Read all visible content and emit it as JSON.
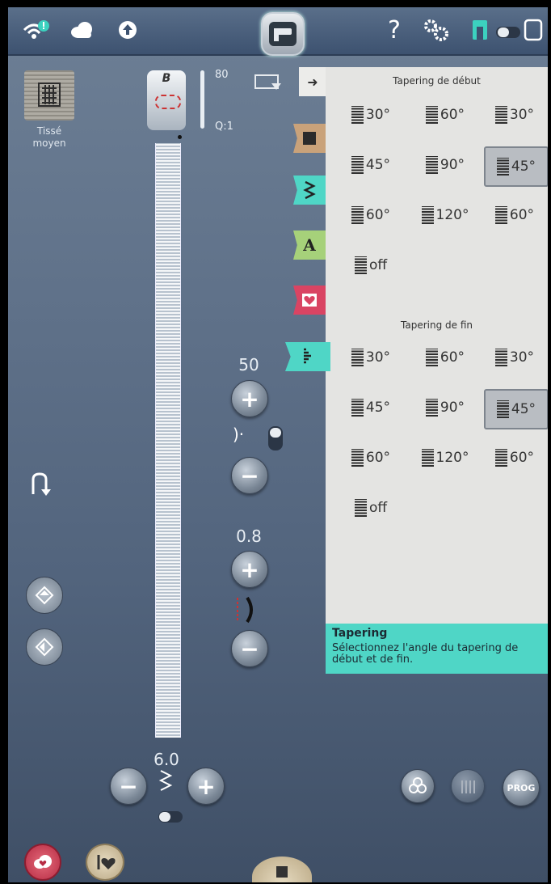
{
  "topbar": {
    "help_label": "?"
  },
  "fabric": {
    "line1": "Tissé",
    "line2": "moyen"
  },
  "presser": {
    "letter": "B",
    "needle_size": "80",
    "q_value": "Q:1"
  },
  "panel": {
    "start_title": "Tapering de début",
    "end_title": "Tapering de fin",
    "start_options": [
      {
        "label": "30°"
      },
      {
        "label": "60°"
      },
      {
        "label": "30°"
      },
      {
        "label": "45°"
      },
      {
        "label": "90°"
      },
      {
        "label": "45°",
        "selected": true
      },
      {
        "label": "60°"
      },
      {
        "label": "120°"
      },
      {
        "label": "60°"
      },
      {
        "label": "off"
      }
    ],
    "end_options": [
      {
        "label": "30°"
      },
      {
        "label": "60°"
      },
      {
        "label": "30°"
      },
      {
        "label": "45°"
      },
      {
        "label": "90°"
      },
      {
        "label": "45°",
        "selected": true
      },
      {
        "label": "60°"
      },
      {
        "label": "120°"
      },
      {
        "label": "60°"
      },
      {
        "label": "off"
      }
    ]
  },
  "tabs": {
    "letter_tab": "A"
  },
  "help": {
    "title": "Tapering",
    "description": "Sélectionnez l'angle du tapering de début et de fin."
  },
  "controls": {
    "density": "50",
    "length": "0.8",
    "width": "6.0"
  },
  "bottom": {
    "prog_label": "PROG"
  },
  "colors": {
    "accent": "#4fd6c6",
    "selected": "#b9bdc2",
    "panel": "#e4e4e2"
  }
}
